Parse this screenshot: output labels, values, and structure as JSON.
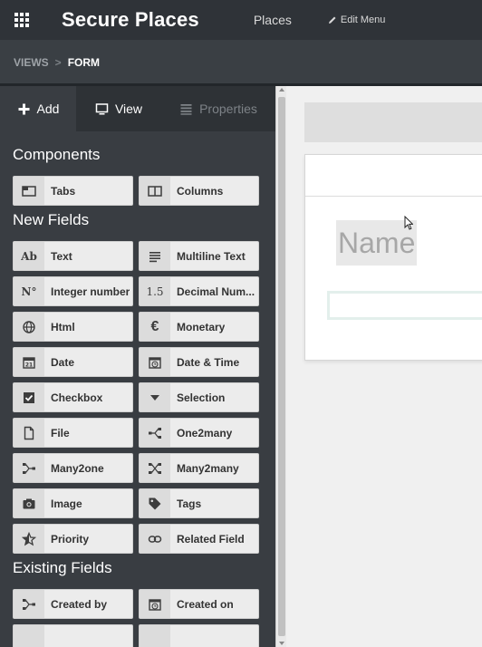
{
  "topbar": {
    "app_title": "Secure Places",
    "menu_places": "Places",
    "edit_menu": "Edit Menu",
    "icons": [
      "apps-icon",
      "pencil-icon"
    ]
  },
  "breadcrumb": {
    "views": "VIEWS",
    "separator": ">",
    "form": "FORM"
  },
  "sidebar": {
    "tabs": [
      {
        "label": "Add",
        "icon": "plus-icon",
        "active": true
      },
      {
        "label": "View",
        "icon": "monitor-icon",
        "active": false
      },
      {
        "label": "Properties",
        "icon": "list-icon",
        "active": false,
        "disabled": true
      }
    ],
    "components_title": "Components",
    "components": [
      {
        "label": "Tabs",
        "icon": "tabs-icon"
      },
      {
        "label": "Columns",
        "icon": "columns-icon"
      }
    ],
    "new_fields_title": "New Fields",
    "new_fields": [
      {
        "label": "Text",
        "icon": "text-icon",
        "glyph": "Ab"
      },
      {
        "label": "Multiline Text",
        "icon": "multiline-icon"
      },
      {
        "label": "Integer number",
        "icon": "integer-icon",
        "glyph": "N°"
      },
      {
        "label": "Decimal Num...",
        "icon": "decimal-icon",
        "glyph": "1.5"
      },
      {
        "label": "Html",
        "icon": "globe-icon"
      },
      {
        "label": "Monetary",
        "icon": "euro-icon",
        "glyph": "€"
      },
      {
        "label": "Date",
        "icon": "calendar-icon"
      },
      {
        "label": "Date & Time",
        "icon": "calendar-clock-icon"
      },
      {
        "label": "Checkbox",
        "icon": "checkbox-icon"
      },
      {
        "label": "Selection",
        "icon": "caret-down-icon"
      },
      {
        "label": "File",
        "icon": "file-icon"
      },
      {
        "label": "One2many",
        "icon": "one2many-icon"
      },
      {
        "label": "Many2one",
        "icon": "many2one-icon"
      },
      {
        "label": "Many2many",
        "icon": "many2many-icon"
      },
      {
        "label": "Image",
        "icon": "camera-icon"
      },
      {
        "label": "Tags",
        "icon": "tag-icon"
      },
      {
        "label": "Priority",
        "icon": "star-icon"
      },
      {
        "label": "Related Field",
        "icon": "link-icon"
      }
    ],
    "existing_fields_title": "Existing Fields",
    "existing_fields": [
      {
        "label": "Created by",
        "icon": "many2one-icon"
      },
      {
        "label": "Created on",
        "icon": "calendar-clock-icon"
      }
    ]
  },
  "form": {
    "name_placeholder": "Name"
  }
}
